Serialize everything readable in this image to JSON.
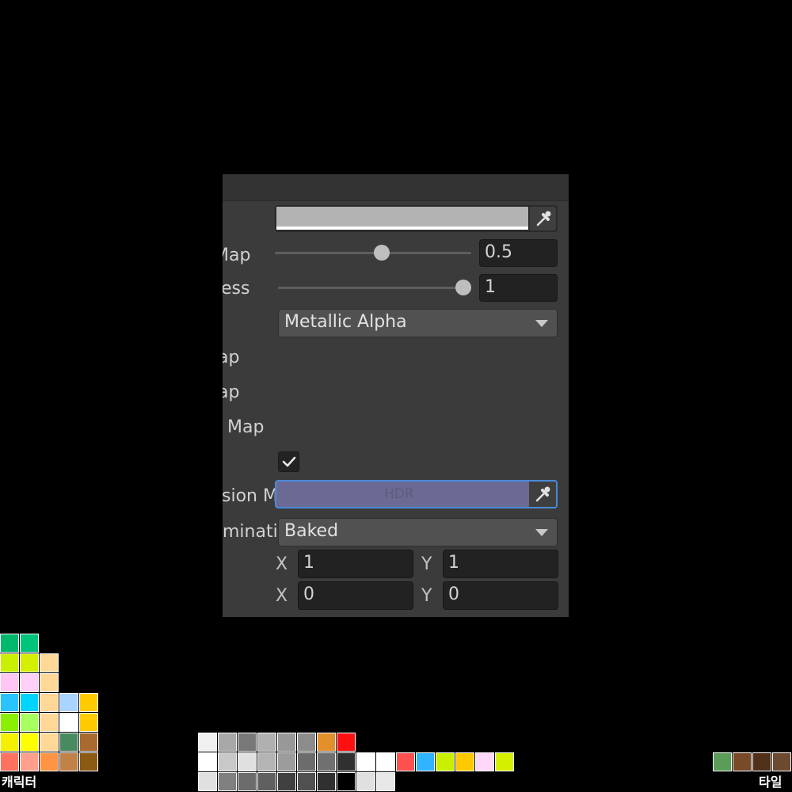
{
  "inspector": {
    "labels": {
      "row1": "",
      "row2": "Map",
      "row3": "ess",
      "row4": "",
      "row5": "ap",
      "row6": "ap",
      "row7": "Map",
      "row8": "",
      "row9": "sion M",
      "row10": "minati",
      "row11": "",
      "row12": ""
    },
    "color_value": "#b3b3b3",
    "metallic_slider": {
      "value": "0.5",
      "fraction": 0.5
    },
    "smoothness_slider": {
      "value": "1",
      "fraction": 1.0
    },
    "source_dropdown": {
      "selected": "Metallic Alpha"
    },
    "emission_checkbox": {
      "checked": true
    },
    "emission_color": {
      "badge": "HDR",
      "color": "#6a6a94"
    },
    "global_illumination": {
      "selected": "Baked"
    },
    "tiling": {
      "x_label": "X",
      "x": "1",
      "y_label": "Y",
      "y": "1"
    },
    "offset": {
      "x_label": "X",
      "x": "0",
      "y_label": "Y",
      "y": "0"
    }
  },
  "palettes": {
    "character": {
      "label": "캐릭터",
      "rows": [
        [
          "#00b86b",
          "#00c47a"
        ],
        [
          "#c8f000",
          "#d4f000",
          "#ffd898"
        ],
        [
          "#ffc6f4",
          "#ffd0f8",
          "#ffd898"
        ],
        [
          "#29c4ff",
          "#00d4ff",
          "#ffd898",
          "#a8d4ff",
          "#ffcc00"
        ],
        [
          "#88f000",
          "#a8ff60",
          "#ffd898",
          "#ffffff",
          "#ffcc00"
        ],
        [
          "#f4f000",
          "#ffff00",
          "#ffd898",
          "#4a8a60",
          "#a86a30"
        ],
        [
          "#ff7260",
          "#ff9f8c",
          "#ff9444",
          "#c08248",
          "#8b5a14"
        ]
      ]
    },
    "neutral": {
      "rows": [
        [
          "#f0f0f0",
          "#a8a8a8",
          "#787878",
          "#b0b0b0",
          "#989898",
          "#8c8c8c",
          "#e2902c",
          "#ff1010"
        ],
        [
          "#ffffff",
          "#c8c8c8",
          "#e0e0e0",
          "#b4b4b4",
          "#9c9c9c",
          "#6c6c6c",
          "#707070",
          "#303030",
          "#ffffff",
          "#ffffff",
          "#ff5050",
          "#30b4ff",
          "#c8f000",
          "#ffc800",
          "#ffd8f8",
          "#d4f000"
        ],
        [
          "#e0e0e0",
          "#808080",
          "#6c6c6c",
          "#606060",
          "#404040",
          "#505050",
          "#303030",
          "#000000",
          "#e0e0e0",
          "#e8e8e8"
        ]
      ]
    },
    "tile": {
      "label": "타일",
      "rows": [
        [
          "#5a9c58",
          "#784a28",
          "#503018",
          "#6c4a30"
        ]
      ]
    }
  }
}
